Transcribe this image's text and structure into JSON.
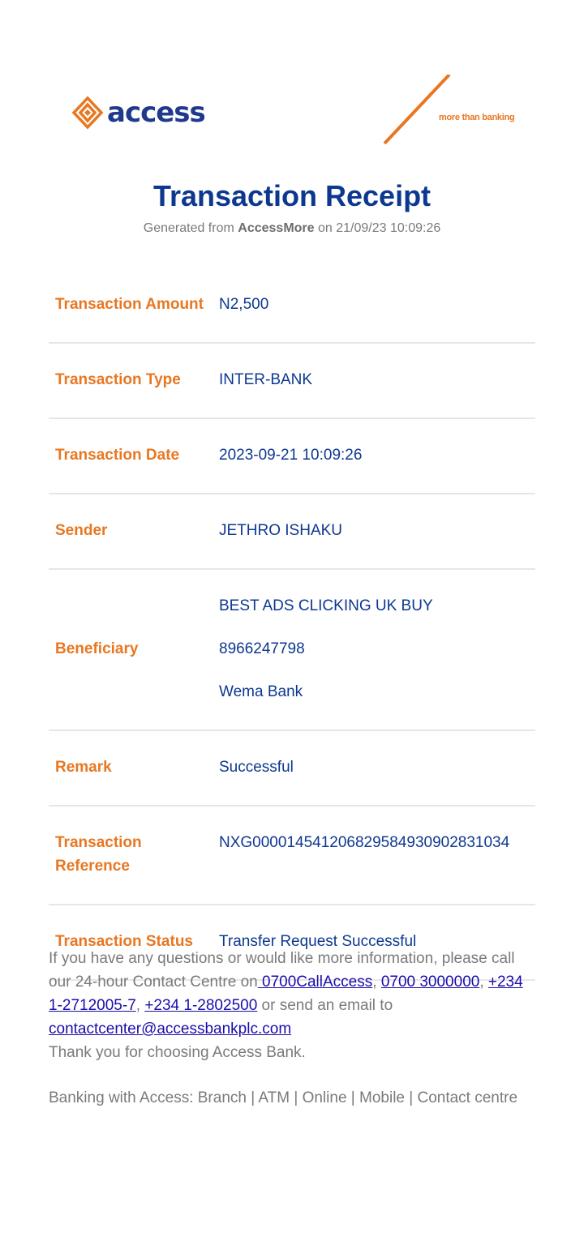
{
  "brand": {
    "name": "access",
    "tagline": "more than banking",
    "colors": {
      "navy": "#0d3890",
      "orange": "#e87722",
      "grey": "#7a7a7a",
      "link": "#1a0dab"
    }
  },
  "receipt": {
    "title": "Transaction Receipt",
    "generated_prefix": "Generated from",
    "generated_app": "AccessMore",
    "generated_suffix": "on 21/09/23 10:09:26"
  },
  "rows": [
    {
      "label": "Transaction Amount",
      "value": "N2,500"
    },
    {
      "label": "Transaction Type",
      "value": "INTER-BANK"
    },
    {
      "label": "Transaction Date",
      "value": "2023-09-21 10:09:26"
    },
    {
      "label": "Sender",
      "value": "JETHRO ISHAKU"
    },
    {
      "label": "Beneficiary",
      "lines": [
        "BEST ADS CLICKING UK BUY",
        "8966247798",
        "Wema Bank"
      ]
    },
    {
      "label": "Remark",
      "value": "Successful"
    },
    {
      "label": "Transaction Reference",
      "value": "NXG000014541206829584930902831034"
    },
    {
      "label": "Transaction Status",
      "value": "Transfer Request Successful"
    }
  ],
  "footer": {
    "text1": "If you have any questions or would like more information, please call our 24-hour Contact Centre on",
    "link1": " 0700CallAccess",
    "sep1": ", ",
    "link2": "0700 3000000",
    "sep2": ", ",
    "link3": "+234 1-2712005-7",
    "sep3": ", ",
    "link4": "+234 1-2802500",
    "text2": " or send an email to ",
    "email": "contactcenter@accessbankplc.com",
    "thanks": "Thank you for choosing Access Bank.",
    "channels": "Banking with Access: Branch | ATM | Online | Mobile | Contact centre"
  }
}
